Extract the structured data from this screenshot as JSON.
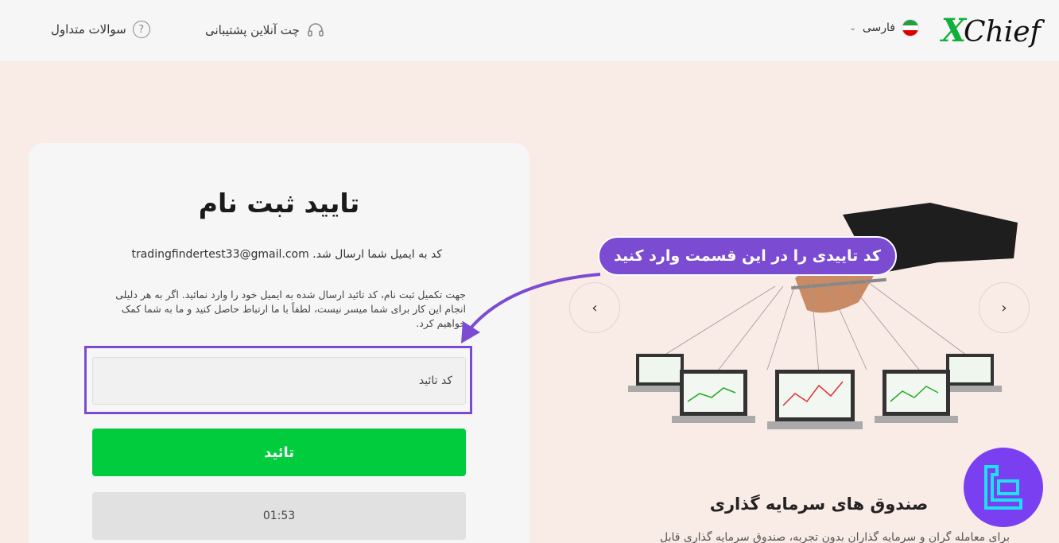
{
  "header": {
    "logo_text": "XChief",
    "language": {
      "label": "فارسی",
      "flag": "iran-flag-icon"
    },
    "nav": {
      "chat_label": "چت آنلاین پشتیبانی",
      "faq_label": "سوالات متداول"
    }
  },
  "form": {
    "title": "تایید ثبت نام",
    "sent_message": "کد به ایمیل شما ارسال شد. tradingfindertest33@gmail.com",
    "description": "جهت تکمیل ثبت نام، کد تائید ارسال شده به ایمیل خود را وارد نمائید. اگر به هر دلیلی انجام این کار برای شما میسر نیست، لطفاً با ما ارتباط حاصل کنید و ما به شما کمک خواهیم کرد.",
    "code_input": {
      "placeholder": "کد تائید",
      "value": ""
    },
    "confirm_label": "تائید",
    "timer": "01:53"
  },
  "annotation": {
    "callout_text": "کد تاییدی را در این قسمت وارد کنید"
  },
  "carousel": {
    "prev_symbol": "‹",
    "next_symbol": "›",
    "slide_title": "صندوق های سرمایه گذاری",
    "slide_description": "برای معامله گران و سرمایه گذاران بدون تجربه، صندوق سرمایه گذاری قابل"
  },
  "colors": {
    "accent_purple": "#7b4bd1",
    "confirm_green": "#00cc3d",
    "page_background": "#f9ebe6",
    "logo_green": "#12b03a"
  }
}
